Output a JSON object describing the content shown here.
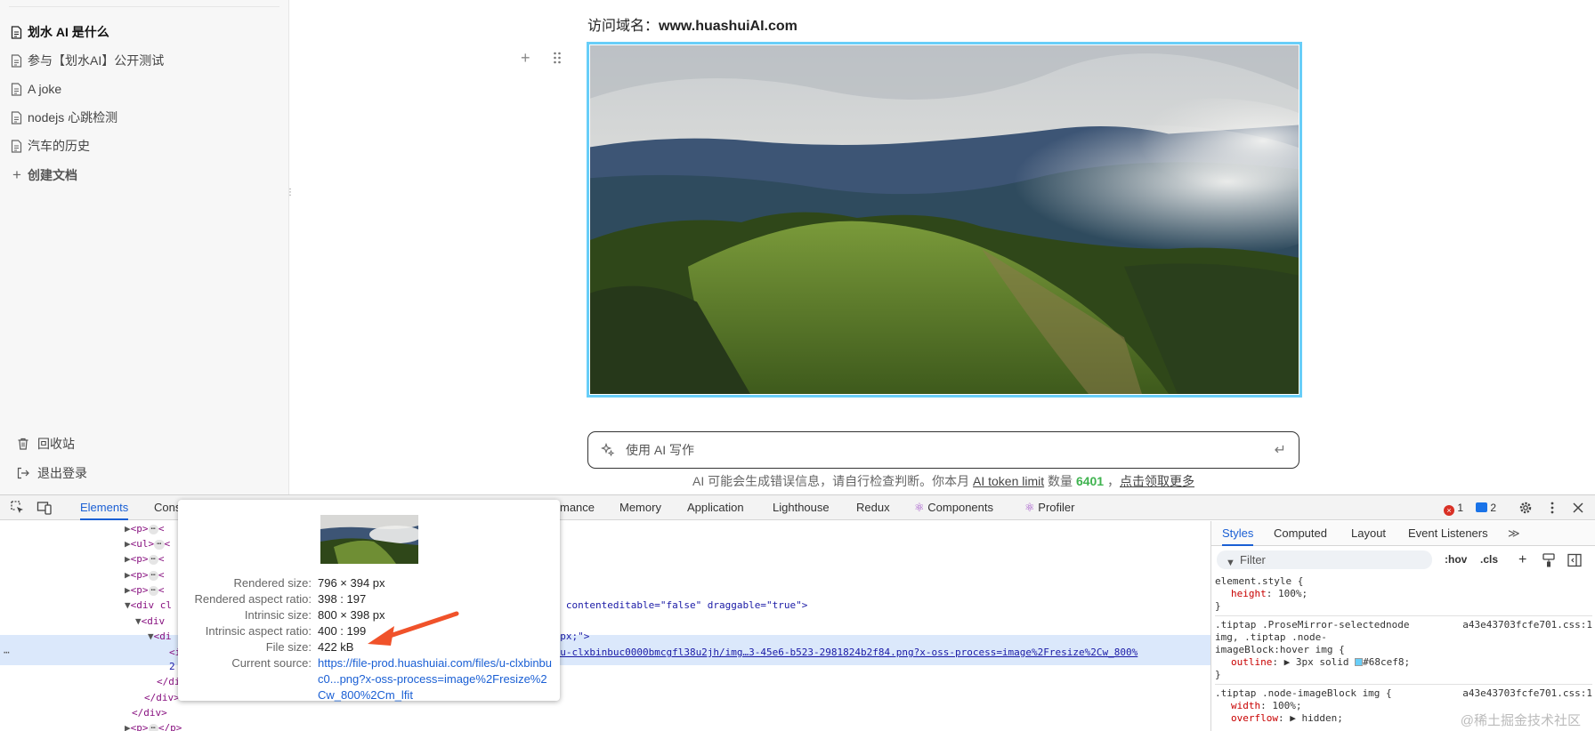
{
  "sidebar": {
    "docs": [
      {
        "label": "划水 AI 是什么",
        "active": true
      },
      {
        "label": "参与【划水AI】公开测试",
        "active": false
      },
      {
        "label": "A joke",
        "active": false
      },
      {
        "label": "nodejs 心跳检测",
        "active": false
      },
      {
        "label": "汽车的历史",
        "active": false
      }
    ],
    "create_label": "创建文档",
    "trash_label": "回收站",
    "logout_label": "退出登录"
  },
  "editor": {
    "domain_label": "访问域名：",
    "domain_value": "www.huashuiAI.com",
    "ai_placeholder": "使用 AI 写作",
    "note_prefix": "AI 可能会生成错误信息，请自行检查判断。你本月 ",
    "note_token_link": "AI token limit",
    "note_count_label": " 数量 ",
    "note_count": "6401",
    "note_sep": " ，",
    "note_more_link": "点击领取更多"
  },
  "devtools": {
    "tabs": [
      "Elements",
      "Cons",
      "mance",
      "Memory",
      "Application",
      "Lighthouse",
      "Redux",
      "Components",
      "Profiler"
    ],
    "error_count": "1",
    "message_count": "2",
    "code_fragments": {
      "contenteditable": "e\" contenteditable=\"false\" draggable=\"true\">",
      "style_frag": "01px;\">",
      "src_frag": "s/u-clxbinbuc0000bmcgfl38u2jh/img…3-45e6-b523-2981824b2f84.png?x-oss-process=image%2Fresize%2Cw_800%",
      "sel_prefix": "2"
    },
    "styles": {
      "tabs": [
        "Styles",
        "Computed",
        "Layout",
        "Event Listeners"
      ],
      "filter_placeholder": "Filter",
      "hov": ":hov",
      "cls": ".cls",
      "rules": [
        {
          "selector": "element.style {",
          "decls": [
            {
              "prop": "height",
              "val": "100%;"
            }
          ],
          "close": "}"
        },
        {
          "selector": ".tiptap .ProseMirror-selectednode",
          "selector2": "img, .tiptap .node-",
          "selector3": "imageBlock:hover img {",
          "source": "a43e43703fcfe701.css:1",
          "decls": [
            {
              "prop": "outline",
              "val": "3px solid",
              "color": "#68cef8;"
            }
          ],
          "close": "}"
        },
        {
          "selector": ".tiptap .node-imageBlock img {",
          "source": "a43e43703fcfe701.css:1",
          "decls": [
            {
              "prop": "width",
              "val": "100%;"
            },
            {
              "prop": "overflow",
              "val": "hidden;"
            }
          ]
        }
      ]
    }
  },
  "tooltip": {
    "rows": [
      {
        "label": "Rendered size:",
        "value": "796 × 394 px"
      },
      {
        "label": "Rendered aspect ratio:",
        "value": "398 : 197"
      },
      {
        "label": "Intrinsic size:",
        "value": "800 × 398 px"
      },
      {
        "label": "Intrinsic aspect ratio:",
        "value": "400 : 199"
      },
      {
        "label": "File size:",
        "value": "422 kB"
      }
    ],
    "source_label": "Current source:",
    "source_value": "https://file-prod.huashuiai.com/files/u-clxbinbuc0...png?x-oss-process=image%2Fresize%2Cw_800%2Cm_lfit"
  },
  "watermark": "@稀土掘金技术社区",
  "colors": {
    "selection_outline": "#68cef8",
    "devtools_active": "#1a5fd4",
    "count_green": "#3fb34f"
  }
}
